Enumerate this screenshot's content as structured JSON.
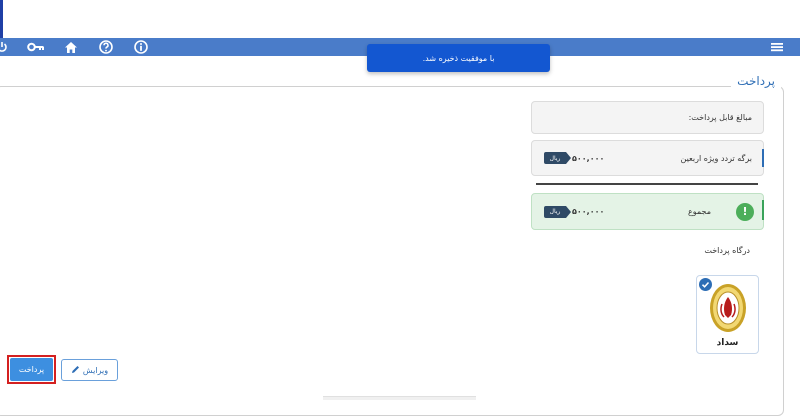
{
  "toast": {
    "message": "با موفقیت ذخیره شد."
  },
  "nav": {
    "icons": [
      "power-icon",
      "key-icon",
      "home-icon",
      "help-icon",
      "info-icon",
      "menu-icon"
    ]
  },
  "payment": {
    "title": "پرداخت",
    "payable_amounts_label": "مبالغ قابل پرداخت:",
    "items": [
      {
        "label": "برگه تردد ویژه اربعین",
        "amount": "۵۰۰,۰۰۰",
        "currency": "ریال"
      }
    ],
    "total": {
      "label": "مجموع",
      "amount": "۵۰۰,۰۰۰",
      "currency": "ریال",
      "icon": "!"
    },
    "gateway_title": "درگاه پرداخت",
    "gateway": {
      "name": "سداد",
      "selected": true
    }
  },
  "actions": {
    "edit_label": "ویرایش",
    "pay_label": "پرداخت"
  },
  "colors": {
    "navbar": "#4a7cc9",
    "toast": "#1357d1",
    "accent": "#2d6db5",
    "success": "#4cae5a",
    "highlight": "#d42020"
  }
}
